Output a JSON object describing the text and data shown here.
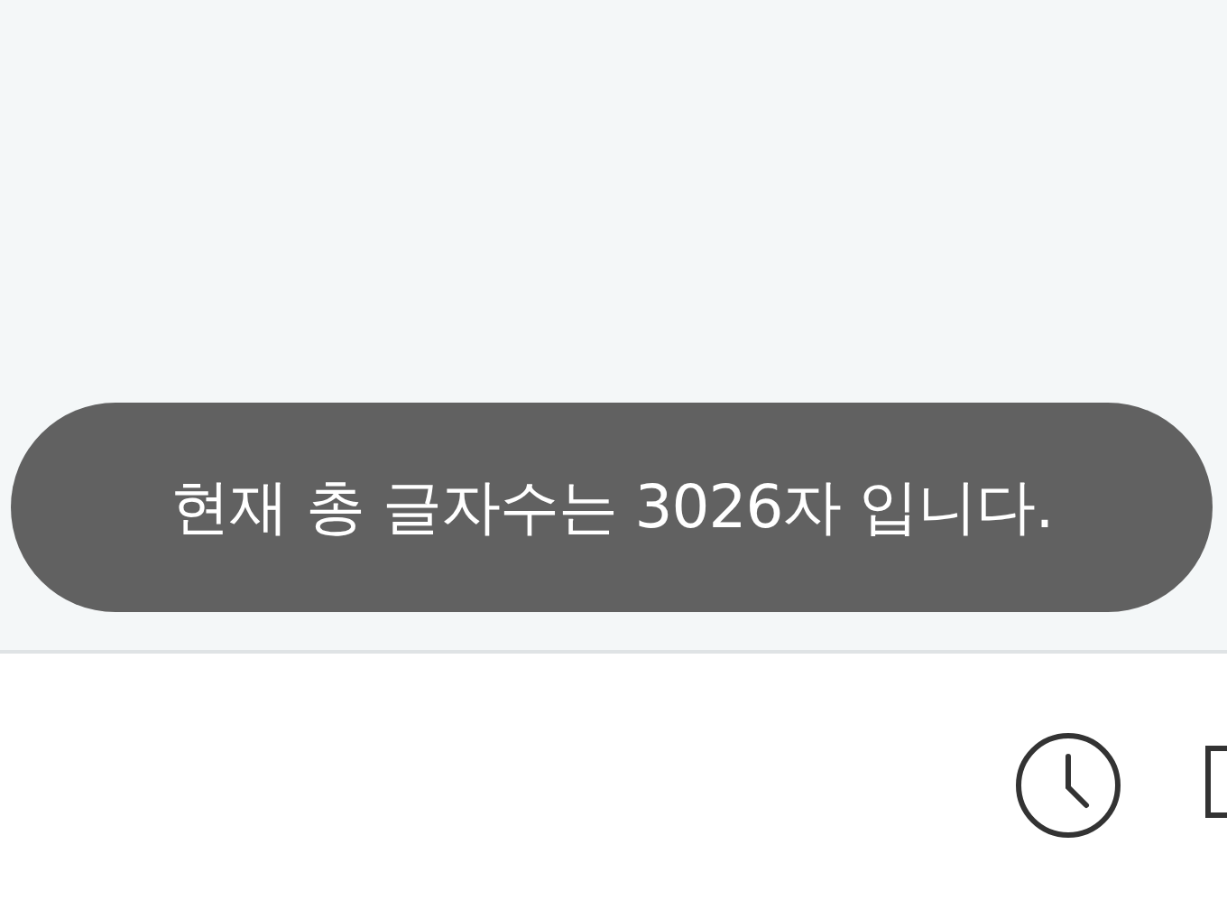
{
  "toast": {
    "message": "현재 총 글자수는 3026자 입니다."
  }
}
